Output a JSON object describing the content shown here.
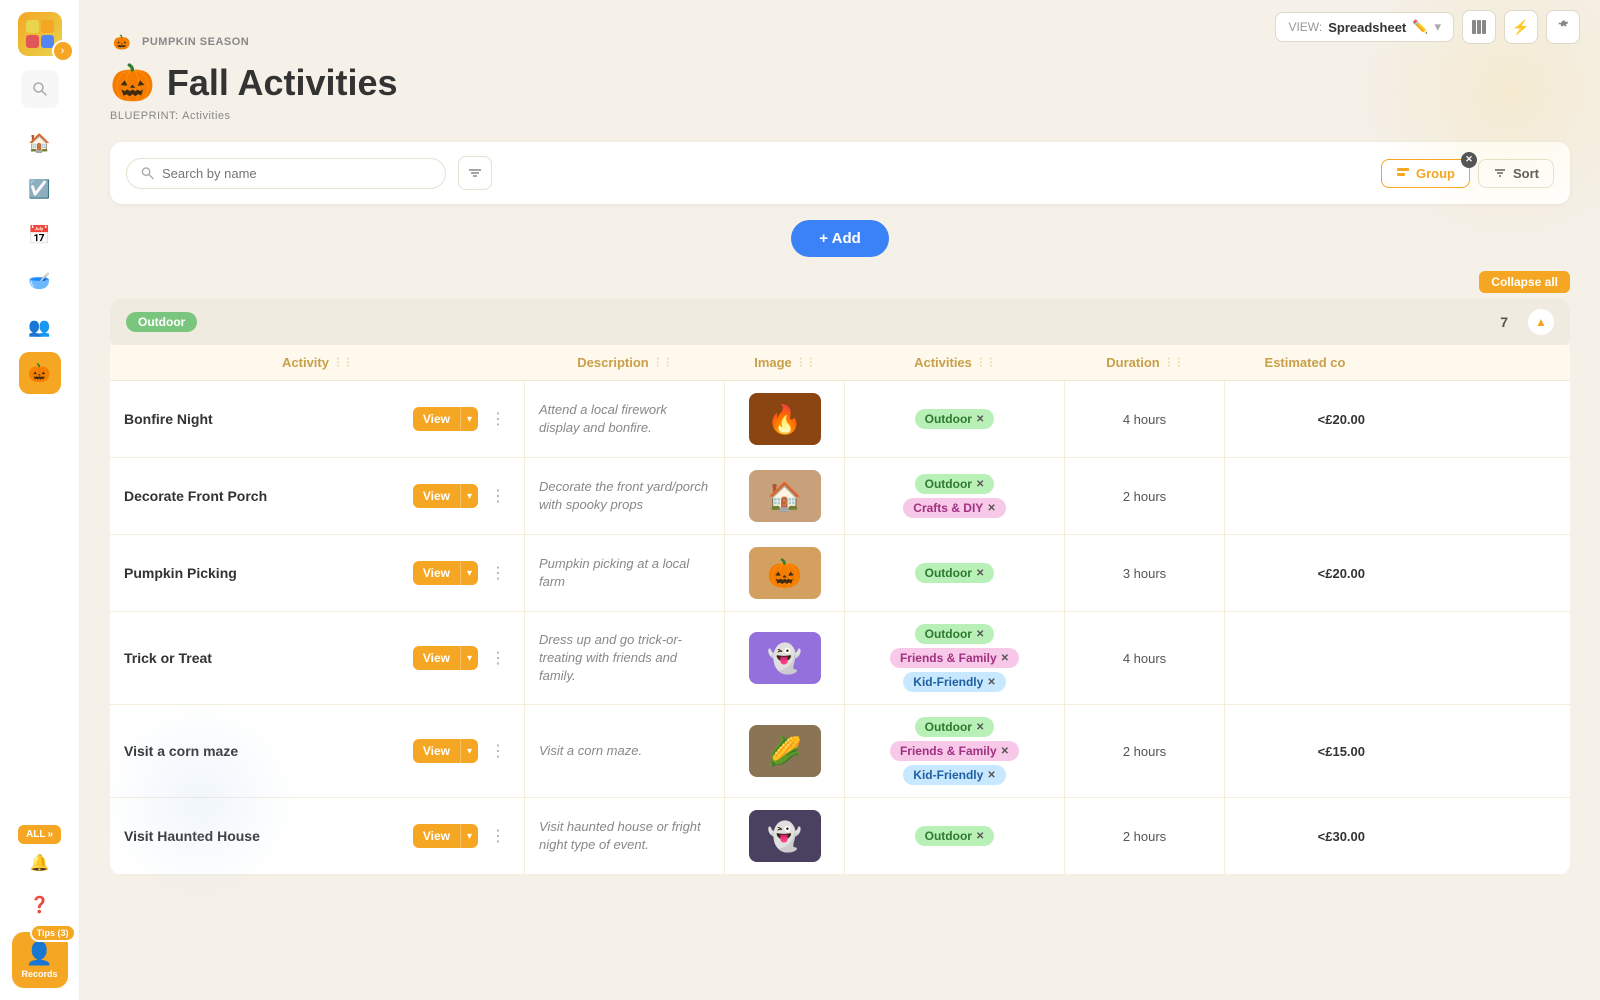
{
  "app": {
    "title": "Fall Activities"
  },
  "sidebar": {
    "records_label": "Records",
    "tips_label": "Tips (3)",
    "all_label": "ALL",
    "icons": [
      "home",
      "check",
      "calendar",
      "bowl",
      "group",
      "pumpkin",
      "bell",
      "help"
    ]
  },
  "top_bar": {
    "view_label": "VIEW:",
    "view_name": "Spreadsheet",
    "icons": [
      "edit",
      "chevron-down",
      "list",
      "bolt",
      "sliders"
    ]
  },
  "header": {
    "breadcrumb": "PUMPKIN SEASON",
    "title_icon": "🎃",
    "title": "Fall Activities",
    "blueprint_label": "BLUEPRINT:",
    "blueprint_value": "Activities"
  },
  "toolbar": {
    "search_placeholder": "Search by name",
    "group_label": "Group",
    "sort_label": "Sort"
  },
  "add_button": {
    "label": "+ Add"
  },
  "collapse_button": {
    "label": "Collapse all"
  },
  "group": {
    "name": "Outdoor",
    "count": "7"
  },
  "columns": [
    {
      "label": "Activity"
    },
    {
      "label": "Description"
    },
    {
      "label": "Image"
    },
    {
      "label": "Activities"
    },
    {
      "label": "Duration"
    },
    {
      "label": "Estimated co"
    }
  ],
  "rows": [
    {
      "name": "Bonfire Night",
      "description": "Attend a local firework display and bonfire.",
      "image_emoji": "🔥",
      "image_bg": "#8B4513",
      "tags": [
        {
          "label": "Outdoor",
          "color": "green"
        }
      ],
      "duration": "4 hours",
      "cost": "<£20.00"
    },
    {
      "name": "Decorate Front Porch",
      "description": "Decorate the front yard/porch with spooky props",
      "image_emoji": "🏠",
      "image_bg": "#c8a07a",
      "tags": [
        {
          "label": "Outdoor",
          "color": "green"
        },
        {
          "label": "Crafts & DIY",
          "color": "pink"
        }
      ],
      "duration": "2 hours",
      "cost": ""
    },
    {
      "name": "Pumpkin Picking",
      "description": "Pumpkin picking at a local farm",
      "image_emoji": "🎃",
      "image_bg": "#d4a060",
      "tags": [
        {
          "label": "Outdoor",
          "color": "green"
        }
      ],
      "duration": "3 hours",
      "cost": "<£20.00"
    },
    {
      "name": "Trick or Treat",
      "description": "Dress up and go trick-or-treating with friends and family.",
      "image_emoji": "👻",
      "image_bg": "#9370DB",
      "tags": [
        {
          "label": "Outdoor",
          "color": "green"
        },
        {
          "label": "Friends & Family",
          "color": "pink"
        },
        {
          "label": "Kid-Friendly",
          "color": "blue"
        }
      ],
      "duration": "4 hours",
      "cost": ""
    },
    {
      "name": "Visit a corn maze",
      "description": "Visit a corn maze.",
      "image_emoji": "🌽",
      "image_bg": "#8B7355",
      "tags": [
        {
          "label": "Outdoor",
          "color": "green"
        },
        {
          "label": "Friends & Family",
          "color": "pink"
        },
        {
          "label": "Kid-Friendly",
          "color": "blue"
        }
      ],
      "duration": "2 hours",
      "cost": "<£15.00"
    },
    {
      "name": "Visit Haunted House",
      "description": "Visit haunted house or fright night type of event.",
      "image_emoji": "👻",
      "image_bg": "#4a4060",
      "tags": [
        {
          "label": "Outdoor",
          "color": "green"
        }
      ],
      "duration": "2 hours",
      "cost": "<£30.00"
    }
  ]
}
